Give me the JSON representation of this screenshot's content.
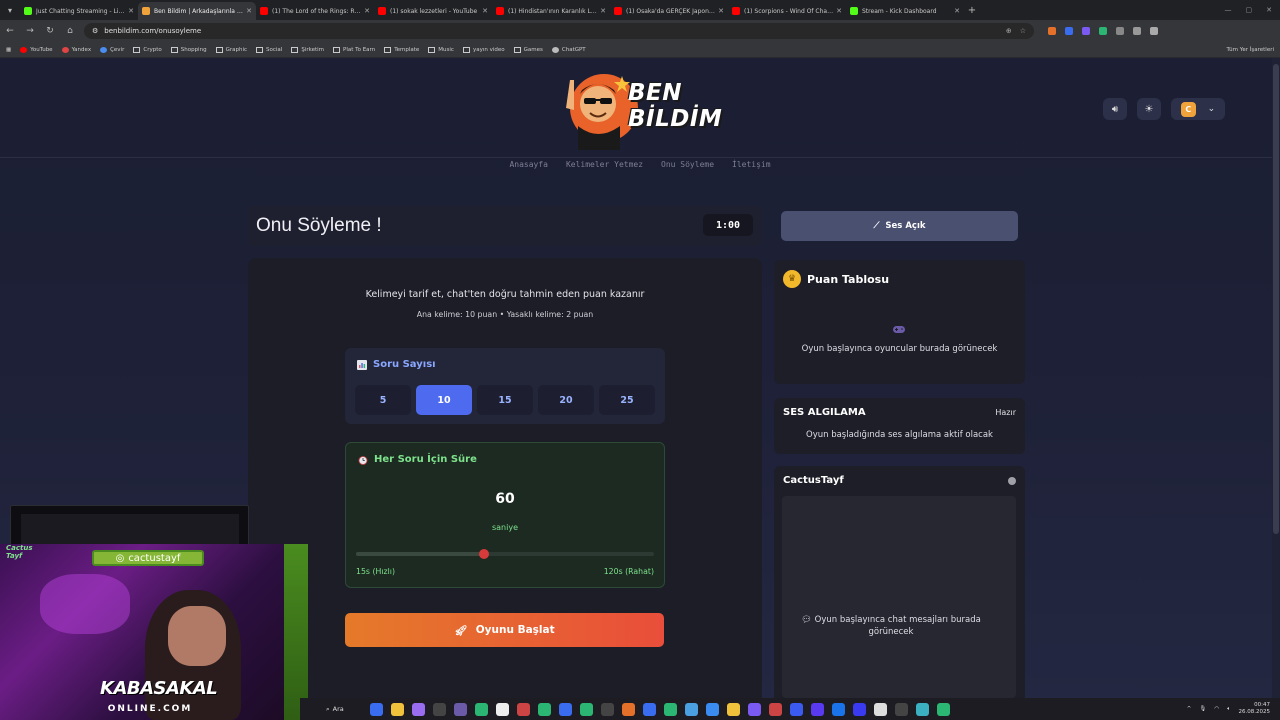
{
  "browser": {
    "tabs": [
      {
        "title": "Just Chatting Streaming - Live",
        "color": "#53fc18",
        "active": false
      },
      {
        "title": "Ben Bildim | Arkadaşlarınla Onl",
        "color": "#f0a23b",
        "active": true
      },
      {
        "title": "(1) The Lord of the Rings: Riven",
        "color": "#ff0000",
        "active": false
      },
      {
        "title": "(1) sokak lezzetleri - YouTube",
        "color": "#ff0000",
        "active": false
      },
      {
        "title": "(1) Hindistan'ının Karanlık Lezzet",
        "color": "#ff0000",
        "active": false
      },
      {
        "title": "(1) Osaka'da GERÇEK Japon Sok",
        "color": "#ff0000",
        "active": false
      },
      {
        "title": "(1) Scorpions - Wind Of Chang",
        "color": "#ff0000",
        "active": false
      },
      {
        "title": "Stream - Kick Dashboard",
        "color": "#53fc18",
        "active": false
      }
    ],
    "url": "benbildim.com/onusoyleme",
    "bookmarks": [
      "YouTube",
      "Yandex",
      "Çevir",
      "Crypto",
      "Shopping",
      "Graphic",
      "Social",
      "Şirketim",
      "Plat To Earn",
      "Template",
      "Music",
      "yayın video",
      "Games",
      "ChatGPT"
    ],
    "bookmarks_right": "Tüm Yer İşaretleri"
  },
  "header": {
    "logo_line1": "BEN",
    "logo_line2": "BİLDİM",
    "user_initial": "C"
  },
  "nav": {
    "items": [
      "Anasayfa",
      "Kelimeler Yetmez",
      "Onu Söyleme",
      "İletişim"
    ]
  },
  "game": {
    "title": "Onu Söyleme !",
    "timer": "1:00",
    "instruction": "Kelimeyi tarif et, chat'ten doğru tahmin eden puan kazanır",
    "points": "Ana kelime: 10 puan • Yasaklı kelime: 2 puan",
    "question_count": {
      "label": "Soru Sayısı",
      "options": [
        "5",
        "10",
        "15",
        "20",
        "25"
      ],
      "selected": "10"
    },
    "time_per_question": {
      "label": "Her Soru İçin Süre",
      "value": "60",
      "unit": "saniye",
      "min_label": "15s (Hızlı)",
      "max_label": "120s (Rahat)",
      "min": 15,
      "max": 120,
      "current": 60
    },
    "start_label": "Oyunu Başlat"
  },
  "sidebar": {
    "sound_label": "Ses Açık",
    "scoreboard_title": "Puan Tablosu",
    "scoreboard_empty": "Oyun başlayınca oyuncular burada görünecek",
    "voice_title": "SES ALGILAMA",
    "voice_status": "Hazır",
    "voice_msg": "Oyun başladığında ses algılama aktif olacak",
    "chat_user": "CactusTayf",
    "chat_empty": "Oyun başlayınca chat mesajları burada görünecek"
  },
  "overlay": {
    "cam_name": "cactustayf",
    "brand_line1": "KABASAKAL",
    "brand_line2": "ONLINE.COM",
    "cactus_tag": "Cactus Tayf"
  },
  "taskbar": {
    "search_label": "Ara",
    "time": "00:47",
    "date": "26.08.2025"
  },
  "colors": {
    "accent": "#4e6bf0",
    "green": "#7ee28b",
    "start_gradient_from": "#e57a2a",
    "start_gradient_to": "#e94e3a",
    "trophy": "#f1b82c"
  }
}
